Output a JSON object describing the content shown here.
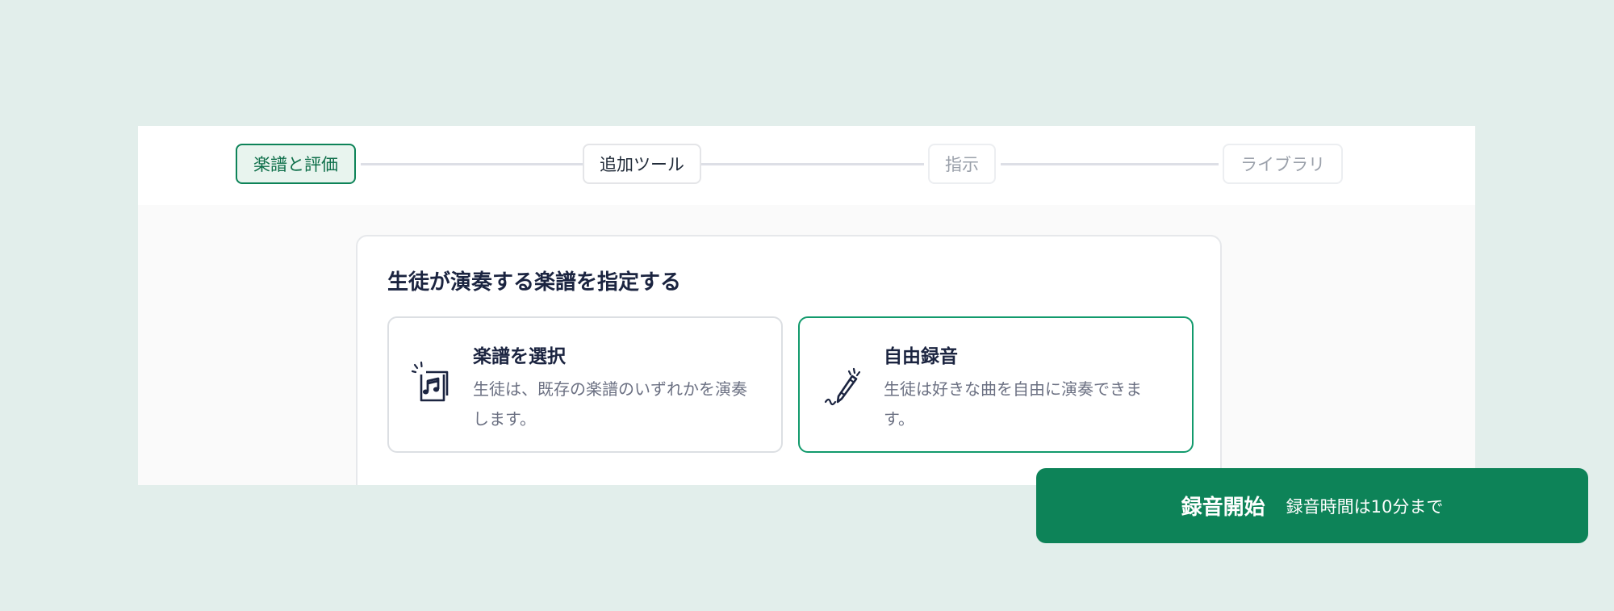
{
  "stepper": {
    "steps": [
      {
        "label": "楽譜と評価",
        "state": "active"
      },
      {
        "label": "追加ツール",
        "state": "default"
      },
      {
        "label": "指示",
        "state": "disabled"
      },
      {
        "label": "ライブラリ",
        "state": "disabled"
      }
    ]
  },
  "card": {
    "title": "生徒が演奏する楽譜を指定する",
    "options": [
      {
        "title": "楽譜を選択",
        "description": "生徒は、既存の楽譜のいずれかを演奏します。",
        "icon": "sheet-music-icon",
        "selected": false
      },
      {
        "title": "自由録音",
        "description": "生徒は好きな曲を自由に演奏できます。",
        "icon": "pencil-icon",
        "selected": true
      }
    ]
  },
  "record": {
    "label": "録音開始",
    "note": "録音時間は10分まで"
  },
  "colors": {
    "background": "#e2eeeb",
    "accent": "#0d8358",
    "active_step_bg": "#e8f4ee",
    "selected_border": "#129a6c",
    "title_text": "#1b2440",
    "muted_text": "#6b7082"
  }
}
